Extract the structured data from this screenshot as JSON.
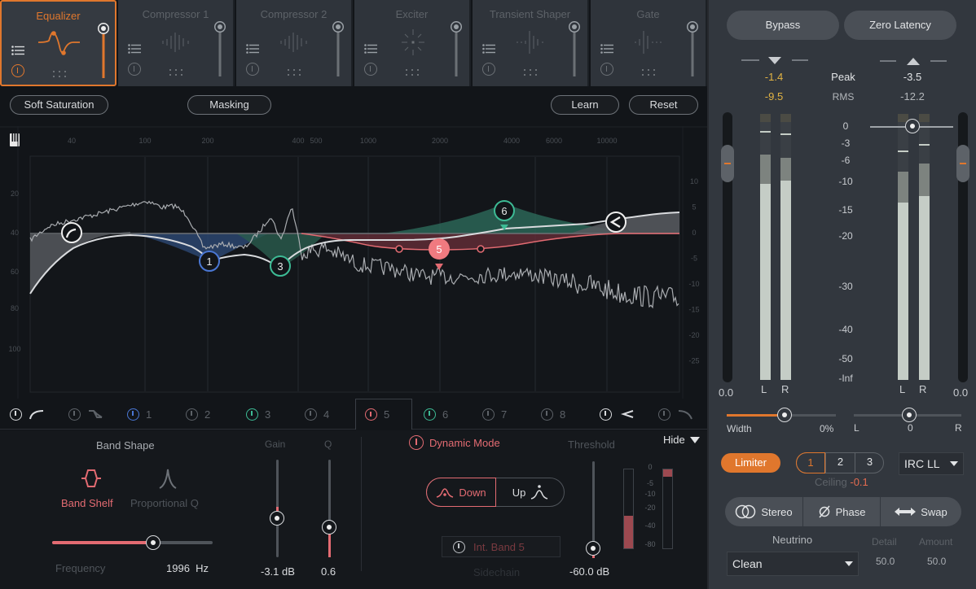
{
  "modules": [
    {
      "name": "Equalizer",
      "active": true
    },
    {
      "name": "Compressor 1",
      "active": false
    },
    {
      "name": "Compressor 2",
      "active": false
    },
    {
      "name": "Exciter",
      "active": false
    },
    {
      "name": "Transient Shaper",
      "active": false
    },
    {
      "name": "Gate",
      "active": false
    }
  ],
  "toolbar": {
    "soft_saturation": "Soft Saturation",
    "masking": "Masking",
    "learn": "Learn",
    "reset": "Reset"
  },
  "graph": {
    "freq_labels": [
      "40",
      "100",
      "200",
      "400",
      "500",
      "1000",
      "2000",
      "4000",
      "6000",
      "10000"
    ],
    "left_axis_labels": [
      "20",
      "40",
      "60",
      "80",
      "100"
    ],
    "right_axis_labels": [
      "10",
      "5",
      "0",
      "-5",
      "-10",
      "-15",
      "-20",
      "-25"
    ],
    "nodes": [
      {
        "id": "lowcut",
        "label": "",
        "color": "#ffffff"
      },
      {
        "id": "1",
        "label": "1",
        "color": "#4a77d4"
      },
      {
        "id": "3",
        "label": "3",
        "color": "#3dbb95"
      },
      {
        "id": "5",
        "label": "5",
        "color": "#e36b72"
      },
      {
        "id": "6",
        "label": "6",
        "color": "#3dbb95"
      },
      {
        "id": "highshelf",
        "label": "",
        "color": "#ffffff"
      }
    ]
  },
  "band_tabs": [
    {
      "id": "lowcut",
      "label": "",
      "icon": "low-cut-icon",
      "color": "#d9dbde",
      "enabled": true
    },
    {
      "id": "lowshelf",
      "label": "",
      "icon": "low-shelf-icon",
      "color": "#5d6268",
      "enabled": false
    },
    {
      "id": "1",
      "label": "1",
      "color": "#4a77d4",
      "enabled": true
    },
    {
      "id": "2",
      "label": "2",
      "color": "#5d6268",
      "enabled": false
    },
    {
      "id": "3",
      "label": "3",
      "color": "#3dbb95",
      "enabled": true
    },
    {
      "id": "4",
      "label": "4",
      "color": "#5d6268",
      "enabled": false
    },
    {
      "id": "5",
      "label": "5",
      "color": "#e36b72",
      "enabled": true,
      "selected": true
    },
    {
      "id": "6",
      "label": "6",
      "color": "#3dbb95",
      "enabled": true
    },
    {
      "id": "7",
      "label": "7",
      "color": "#5d6268",
      "enabled": false
    },
    {
      "id": "8",
      "label": "8",
      "color": "#5d6268",
      "enabled": false
    },
    {
      "id": "highshelf",
      "label": "",
      "icon": "high-shelf-icon",
      "color": "#d9dbde",
      "enabled": true
    },
    {
      "id": "highcut",
      "label": "",
      "icon": "high-cut-icon",
      "color": "#5d6268",
      "enabled": false
    }
  ],
  "band_panel": {
    "band_shape_title": "Band Shape",
    "shape_band_shelf": "Band Shelf",
    "shape_proportional_q": "Proportional Q",
    "frequency_label": "Frequency",
    "frequency_value": "1996",
    "frequency_unit": "Hz",
    "frequency_fraction": 0.63,
    "gain_label": "Gain",
    "gain_value": "-3.1 dB",
    "q_label": "Q",
    "q_value": "0.6",
    "dynamic_mode": "Dynamic Mode",
    "down_label": "Down",
    "up_label": "Up",
    "sidechain_source": "Int. Band 5",
    "sidechain_label": "Sidechain",
    "threshold_label": "Threshold",
    "threshold_value": "-60.0 dB",
    "hide_label": "Hide",
    "gr_scale": [
      "0",
      "-5",
      "-10",
      "-20",
      "-40",
      "-80"
    ]
  },
  "right_panel": {
    "bypass": "Bypass",
    "zero_latency": "Zero Latency",
    "input_peak": "-1.4",
    "input_rms": "-9.5",
    "output_peak": "-3.5",
    "output_rms": "-12.2",
    "peak_label": "Peak",
    "rms_label": "RMS",
    "scale": [
      "0",
      "-3",
      "-6",
      "-10",
      "-15",
      "-20",
      "-30",
      "-40",
      "-50",
      "-Inf"
    ],
    "input_gain": "0.0",
    "output_gain": "0.0",
    "L": "L",
    "R": "R",
    "width_label": "Width",
    "width_value": "0%",
    "pan_L": "L",
    "pan_value": "0",
    "pan_R": "R",
    "limiter": "Limiter",
    "modes": [
      "1",
      "2",
      "3"
    ],
    "selected_mode": "1",
    "irc": "IRC LL",
    "ceiling_label": "Ceiling",
    "ceiling_value": "-0.1",
    "stereo": "Stereo",
    "phase": "Phase",
    "swap": "Swap",
    "neutrino_label": "Neutrino",
    "neutrino_value": "Clean",
    "detail_label": "Detail",
    "detail_value": "50.0",
    "amount_label": "Amount",
    "amount_value": "50.0",
    "accent": "#e0772d"
  }
}
